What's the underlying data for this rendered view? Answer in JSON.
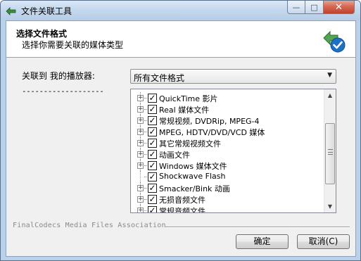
{
  "window": {
    "title": "文件关联工具",
    "buttons": {
      "minimize": "—",
      "maximize": "□",
      "close": "✕"
    }
  },
  "header": {
    "title": "选择文件格式",
    "subtitle": "选择你需要关联的媒体类型"
  },
  "association": {
    "label": "关联到 我的播放器:",
    "separator": "-------------------",
    "select_value": "所有文件格式"
  },
  "tree": {
    "items": [
      {
        "label": "QuickTime 影片",
        "expandable": true,
        "checked": true
      },
      {
        "label": "Real 媒体文件",
        "expandable": true,
        "checked": true
      },
      {
        "label": "常规视频, DVDRip, MPEG-4",
        "expandable": true,
        "checked": true
      },
      {
        "label": "MPEG, HDTV/DVD/VCD 媒体",
        "expandable": true,
        "checked": true
      },
      {
        "label": "其它常规视频文件",
        "expandable": true,
        "checked": true
      },
      {
        "label": "动画文件",
        "expandable": true,
        "checked": true
      },
      {
        "label": "Windows 媒体文件",
        "expandable": true,
        "checked": true
      },
      {
        "label": "Shockwave Flash",
        "expandable": false,
        "checked": true
      },
      {
        "label": "Smacker/Bink 动画",
        "expandable": true,
        "checked": true
      },
      {
        "label": "无损音频文件",
        "expandable": true,
        "checked": true
      },
      {
        "label": "常规音频文件",
        "expandable": true,
        "checked": true
      }
    ]
  },
  "footer": {
    "credit": "FinalCodecs Media Files Association",
    "ok_label": "确定",
    "cancel_label": "取消(C)"
  },
  "colors": {
    "title_bar": "#c4d8ee",
    "close_button": "#c2412b",
    "dialog_bg": "#f0f0f0"
  }
}
